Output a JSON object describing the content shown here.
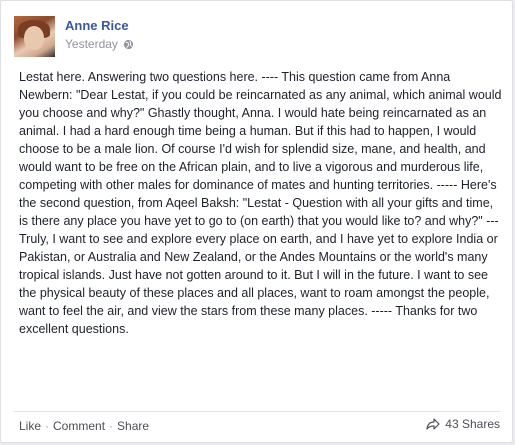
{
  "post": {
    "author": "Anne Rice",
    "timestamp": "Yesterday",
    "privacy_icon": "globe-icon",
    "text": "Lestat here. Answering two questions here. ---- This question came from Anna Newbern: \"Dear Lestat, if you could be reincarnated as any animal, which animal would you choose and why?\" Ghastly thought, Anna. I would hate being reincarnated as an animal. I had a hard enough time being a human. But if this had to happen, I would choose to be a male lion. Of course I'd wish for splendid size, mane, and health, and would want to be free on the African plain, and to live a vigorous and murderous life, competing with other males for dominance of mates and hunting territories. ----- Here's the second question, from Aqeel Baksh: \"Lestat - Question with all your gifts and time, is there any place you have yet to go to (on earth) that you would like to? and why?\" --- Truly, I want to see and explore every place on earth, and I have yet to explore India or Pakistan, or Australia and New Zealand, or the Andes Mountains or the world's many tropical islands. Just have not gotten around to it. But I will in the future. I want to see the physical beauty of these places and all places, want to roam amongst the people, want to feel the air, and view the stars from these many places. ----- Thanks for two excellent questions."
  },
  "actions": {
    "like": "Like",
    "comment": "Comment",
    "share": "Share",
    "separator": "·",
    "shares_count": "43 Shares",
    "shares_icon": "share-arrow-icon"
  },
  "colors": {
    "author_link": "#3b5998",
    "meta_text": "#90949c",
    "body_text": "#1d2129"
  }
}
